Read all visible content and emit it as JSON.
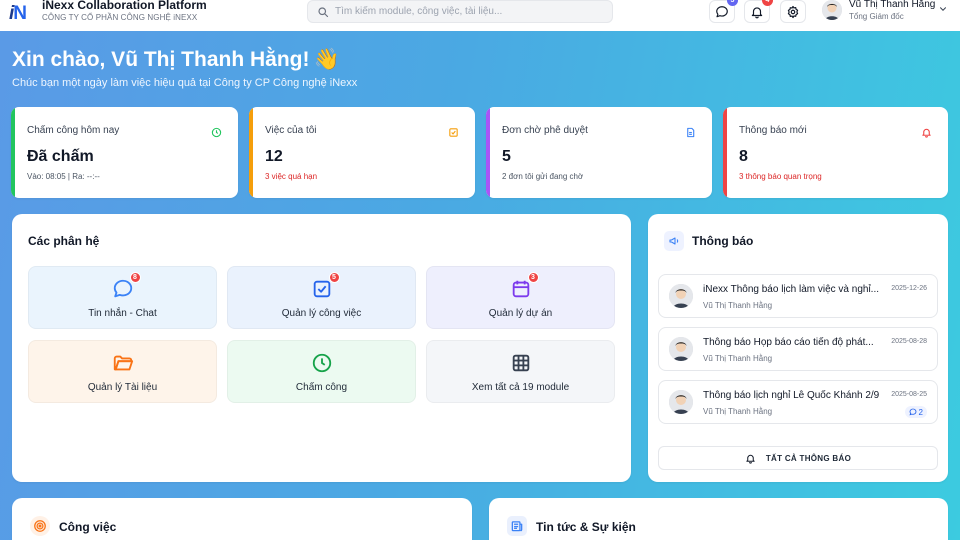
{
  "app": {
    "logo_text_i": "i",
    "logo_text_n": "N",
    "title": "iNexx Collaboration Platform",
    "company": "CÔNG TY CỔ PHẦN CÔNG NGHỆ iNEXX"
  },
  "search": {
    "placeholder": "Tìm kiếm module, công việc, tài liệu..."
  },
  "header": {
    "chat_badge": "5",
    "bell_badge": "4",
    "badge_colors": {
      "chat": "#6366f1",
      "bell": "#ef4444"
    },
    "icons": [
      "chat-icon",
      "bell-icon",
      "gear-icon"
    ]
  },
  "user": {
    "name": "Vũ Thị Thanh Hằng",
    "role": "Tổng Giám đốc"
  },
  "hero": {
    "greeting": "Xin chào, Vũ Thị Thanh Hằng!",
    "wave": "👋",
    "subtitle": "Chúc bạn một ngày làm việc hiệu quả tại Công ty CP Công nghệ iNexx"
  },
  "stats": [
    {
      "label": "Chấm công hôm nay",
      "value": "Đã chấm",
      "sub": "Vào: 08:05 | Ra: --:--",
      "accent": "#22c55e",
      "sub_color": "#4b5563",
      "icon": "clock-icon"
    },
    {
      "label": "Việc của tôi",
      "value": "12",
      "sub": "3 việc quá hạn",
      "accent": "#f59e0b",
      "sub_color": "#dc2626",
      "icon": "checkbox-icon"
    },
    {
      "label": "Đơn chờ phê duyệt",
      "value": "5",
      "sub": "2 đơn tôi gửi đang chờ",
      "accent": "#a855f7",
      "sub_color": "#4b5563",
      "icon": "document-icon"
    },
    {
      "label": "Thông báo mới",
      "value": "8",
      "sub": "3 thông báo quan trọng",
      "accent": "#ef4444",
      "sub_color": "#dc2626",
      "icon": "bell-icon"
    }
  ],
  "modules": {
    "title": "Các phân hệ",
    "items": [
      {
        "label": "Tin nhắn - Chat",
        "badge": "8",
        "bg": "#eaf4fd",
        "color": "#3b82f6",
        "icon": "chat-icon"
      },
      {
        "label": "Quản lý công việc",
        "badge": "5",
        "bg": "#eaf2fd",
        "color": "#2563eb",
        "icon": "task-check-icon"
      },
      {
        "label": "Quản lý dự án",
        "badge": "3",
        "bg": "#eeeffd",
        "color": "#7c3aed",
        "icon": "calendar-icon"
      },
      {
        "label": "Quản lý Tài liệu",
        "badge": "",
        "bg": "#fef4ea",
        "color": "#f97316",
        "icon": "folder-icon"
      },
      {
        "label": "Chấm công",
        "badge": "",
        "bg": "#ecfaf1",
        "color": "#16a34a",
        "icon": "clock-icon"
      },
      {
        "label": "Xem tất cả 19 module",
        "badge": "",
        "bg": "#f4f6f9",
        "color": "#374151",
        "icon": "grid-icon"
      }
    ]
  },
  "notifications": {
    "title": "Thông báo",
    "items": [
      {
        "title": "iNexx Thông báo lịch làm việc và nghỉ...",
        "author": "Vũ Thị Thanh Hằng",
        "date": "2025-12-26",
        "comments": ""
      },
      {
        "title": "Thông báo Họp báo cáo tiến độ phát...",
        "author": "Vũ Thị Thanh Hằng",
        "date": "2025-08-28",
        "comments": ""
      },
      {
        "title": "Thông báo lịch nghỉ Lễ Quốc Khánh 2/9",
        "author": "Vũ Thị Thanh Hằng",
        "date": "2025-08-25",
        "comments": "2"
      }
    ],
    "all_button": "TẤT CẢ THÔNG BÁO"
  },
  "sections": {
    "work_title": "Công việc",
    "news_title": "Tin tức & Sự kiện"
  }
}
